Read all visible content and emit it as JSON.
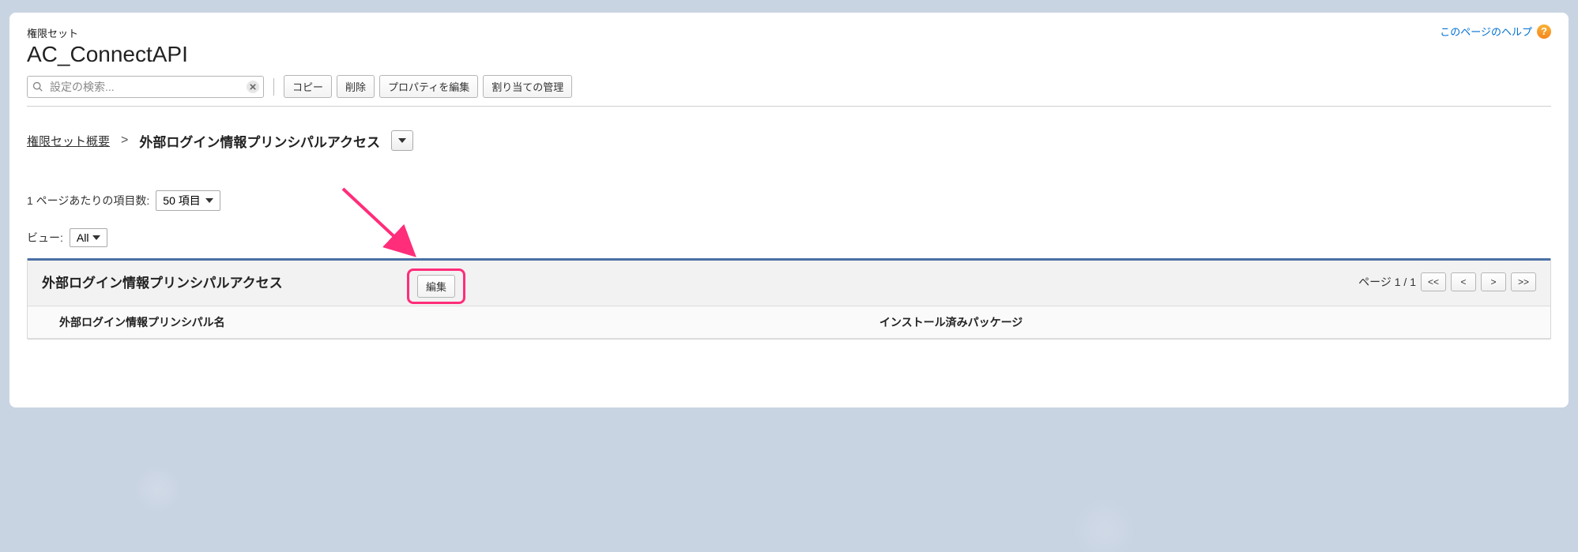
{
  "header": {
    "object_label": "権限セット",
    "title": "AC_ConnectAPI",
    "help_link_text": "このページのヘルプ",
    "help_icon_char": "?"
  },
  "search": {
    "placeholder": "設定の検索..."
  },
  "toolbar": {
    "copy": "コピー",
    "delete": "削除",
    "edit_properties": "プロパティを編集",
    "manage_assignments": "割り当ての管理"
  },
  "breadcrumb": {
    "root": "権限セット概要",
    "separator": ">",
    "current": "外部ログイン情報プリンシパルアクセス"
  },
  "controls": {
    "items_per_page_label": "1 ページあたりの項目数:",
    "items_per_page_value": "50 項目",
    "view_label": "ビュー:",
    "view_value": "All"
  },
  "panel": {
    "title": "外部ログイン情報プリンシパルアクセス",
    "edit_label": "編集",
    "page_label": "ページ 1 / 1",
    "pager": {
      "first": "<<",
      "prev": "<",
      "next": ">",
      "last": ">>"
    },
    "columns": {
      "col1": "外部ログイン情報プリンシパル名",
      "col2": "インストール済みパッケージ"
    }
  }
}
